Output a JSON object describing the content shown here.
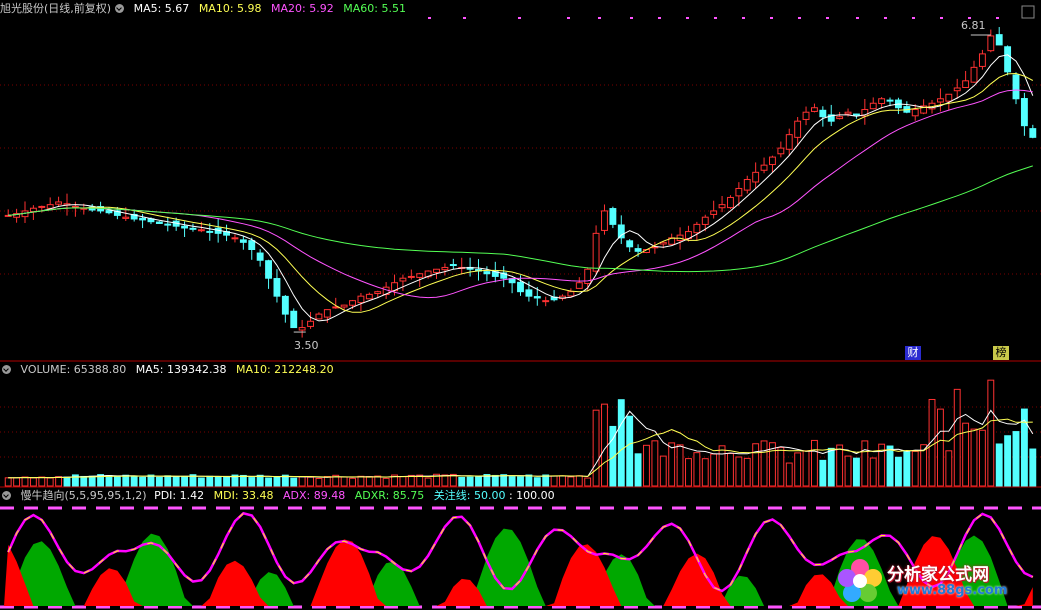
{
  "price_panel": {
    "title": "旭光股份(日线,前复权)",
    "ma5_label": "MA5: 5.67",
    "ma10_label": "MA10: 5.98",
    "ma20_label": "MA20: 5.92",
    "ma60_label": "MA60: 5.51",
    "high_label": "6.81",
    "low_label": "3.50",
    "tag_cai": "财",
    "tag_bang": "榜"
  },
  "volume_panel": {
    "title": "VOLUME: 65388.80",
    "ma5_label": "MA5: 139342.38",
    "ma10_label": "MA10: 212248.20"
  },
  "indicator_panel": {
    "title": "慢牛趋向(5,5,95,95,1,2)",
    "pdi_label": "PDI: 1.42",
    "mdi_label": "MDI: 33.48",
    "adx_label": "ADX: 89.48",
    "adxr_label": "ADXR: 85.75",
    "guanzhu_label": "关注线: 50.00",
    "hundred_label": ": 100.00"
  },
  "watermark": {
    "text": "分析家公式网",
    "url": "www.88gs.com"
  },
  "colors": {
    "up": "#ff3232",
    "down": "#54ffff",
    "ma5": "#ffffff",
    "ma10": "#ffff54",
    "ma20": "#ff54ff",
    "ma60": "#54ff54",
    "separator": "#b00000"
  },
  "chart_data": {
    "type": "line",
    "title": "旭光股份(日线,前复权)",
    "price_markers": {
      "high": 6.81,
      "low": 3.5
    },
    "moving_averages_last": {
      "MA5": 5.67,
      "MA10": 5.98,
      "MA20": 5.92,
      "MA60": 5.51
    },
    "close_series": [
      4.8,
      4.82,
      4.85,
      4.88,
      4.9,
      4.92,
      4.95,
      4.93,
      4.9,
      4.88,
      4.86,
      4.85,
      4.83,
      4.8,
      4.78,
      4.76,
      4.75,
      4.73,
      4.71,
      4.7,
      4.68,
      4.66,
      4.65,
      4.64,
      4.62,
      4.6,
      4.58,
      4.55,
      4.5,
      4.42,
      4.3,
      4.1,
      3.9,
      3.7,
      3.55,
      3.55,
      3.62,
      3.7,
      3.75,
      3.78,
      3.8,
      3.85,
      3.9,
      3.92,
      3.95,
      4.0,
      4.05,
      4.1,
      4.12,
      4.15,
      4.18,
      4.2,
      4.22,
      4.25,
      4.22,
      4.2,
      4.18,
      4.15,
      4.12,
      4.1,
      4.05,
      3.95,
      3.9,
      3.88,
      3.85,
      3.86,
      3.9,
      3.95,
      4.05,
      4.2,
      4.6,
      4.85,
      4.7,
      4.55,
      4.45,
      4.4,
      4.42,
      4.45,
      4.5,
      4.55,
      4.58,
      4.62,
      4.7,
      4.78,
      4.85,
      4.92,
      5.0,
      5.1,
      5.2,
      5.28,
      5.36,
      5.45,
      5.55,
      5.7,
      5.85,
      5.95,
      6.0,
      5.9,
      5.85,
      5.9,
      5.95,
      5.92,
      5.98,
      6.05,
      6.1,
      6.08,
      6.0,
      5.95,
      5.98,
      6.02,
      6.05,
      6.1,
      6.15,
      6.22,
      6.3,
      6.45,
      6.6,
      6.8,
      6.7,
      6.4,
      6.1,
      5.8,
      5.67
    ],
    "volume": {
      "VOLUME": 65388.8,
      "MA5": 139342.38,
      "MA10": 212248.2
    },
    "indicator": {
      "name": "慢牛趋向",
      "params": "5,5,95,95,1,2",
      "PDI": 1.42,
      "MDI": 33.48,
      "ADX": 89.48,
      "ADXR": 85.75,
      "关注线": 50.0,
      "upper": 100.0
    }
  }
}
